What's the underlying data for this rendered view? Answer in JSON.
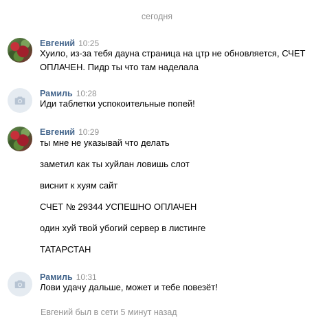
{
  "date_divider": "сегодня",
  "groups": [
    {
      "author": "Евгений",
      "time": "10:25",
      "avatar": "photo",
      "messages": [
        "Хуило, из-за тебя дауна страница на цтр не обновляется, СЧЕТ ОПЛАЧЕН. Пидр ты что там наделала"
      ]
    },
    {
      "author": "Рамиль",
      "time": "10:28",
      "avatar": "camera-icon",
      "messages": [
        "Иди таблетки успокоительные попей!"
      ]
    },
    {
      "author": "Евгений",
      "time": "10:29",
      "avatar": "photo",
      "messages": [
        "ты мне не указывай что делать",
        "заметил как ты хуйлан ловишь слот",
        "виснит к хуям сайт",
        "СЧЕТ № 29344 УСПЕШНО ОПЛАЧЕН",
        "один хуй твой убогий сервер в листинге",
        "ТАТАРСТАН"
      ]
    },
    {
      "author": "Рамиль",
      "time": "10:31",
      "avatar": "camera-icon",
      "messages": [
        "Лови удачу дальше, может и тебе повезёт!"
      ]
    }
  ],
  "status": "Евгений был в сети 5 минут назад",
  "colors": {
    "author": "#42648b",
    "muted": "#939393",
    "avatar_placeholder": "#e5ebf1",
    "camera_icon": "#b7c4d3"
  }
}
